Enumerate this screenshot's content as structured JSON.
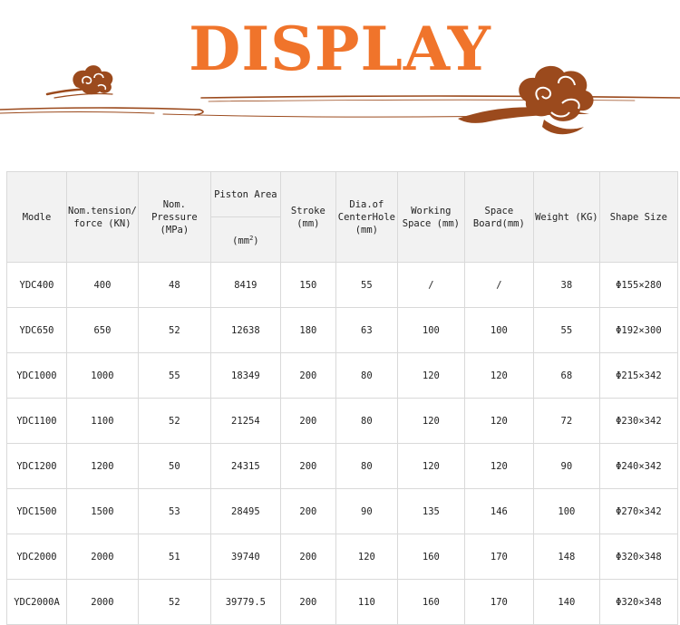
{
  "banner": {
    "title": "DISPLAY",
    "accent_color": "#f0742b",
    "ornament_color": "#9b4a1d"
  },
  "table": {
    "headers": {
      "model": "Modle",
      "tension": "Nom.tension/ force (KN)",
      "pressure": "Nom. Pressure (MPa)",
      "piston_area": "Piston Area",
      "piston_unit": "(mm",
      "piston_unit_sup": "2",
      "piston_unit_close": ")",
      "stroke": "Stroke (mm)",
      "center_hole": "Dia.of CenterHole (mm)",
      "working_space": "Working Space (mm)",
      "space_board": "Space Board(mm)",
      "weight": "Weight (KG)",
      "shape_size": "Shape Size"
    },
    "rows": [
      {
        "model": "YDC400",
        "tension": "400",
        "pressure": "48",
        "area": "8419",
        "stroke": "150",
        "hole": "55",
        "working": "/",
        "board": "/",
        "weight": "38",
        "shape": "Φ155×280"
      },
      {
        "model": "YDC650",
        "tension": "650",
        "pressure": "52",
        "area": "12638",
        "stroke": "180",
        "hole": "63",
        "working": "100",
        "board": "100",
        "weight": "55",
        "shape": "Φ192×300"
      },
      {
        "model": "YDC1000",
        "tension": "1000",
        "pressure": "55",
        "area": "18349",
        "stroke": "200",
        "hole": "80",
        "working": "120",
        "board": "120",
        "weight": "68",
        "shape": "Φ215×342"
      },
      {
        "model": "YDC1100",
        "tension": "1100",
        "pressure": "52",
        "area": "21254",
        "stroke": "200",
        "hole": "80",
        "working": "120",
        "board": "120",
        "weight": "72",
        "shape": "Φ230×342"
      },
      {
        "model": "YDC1200",
        "tension": "1200",
        "pressure": "50",
        "area": "24315",
        "stroke": "200",
        "hole": "80",
        "working": "120",
        "board": "120",
        "weight": "90",
        "shape": "Φ240×342"
      },
      {
        "model": "YDC1500",
        "tension": "1500",
        "pressure": "53",
        "area": "28495",
        "stroke": "200",
        "hole": "90",
        "working": "135",
        "board": "146",
        "weight": "100",
        "shape": "Φ270×342"
      },
      {
        "model": "YDC2000",
        "tension": "2000",
        "pressure": "51",
        "area": "39740",
        "stroke": "200",
        "hole": "120",
        "working": "160",
        "board": "170",
        "weight": "148",
        "shape": "Φ320×348"
      },
      {
        "model": "YDC2000A",
        "tension": "2000",
        "pressure": "52",
        "area": "39779.5",
        "stroke": "200",
        "hole": "110",
        "working": "160",
        "board": "170",
        "weight": "140",
        "shape": "Φ320×348"
      }
    ]
  }
}
